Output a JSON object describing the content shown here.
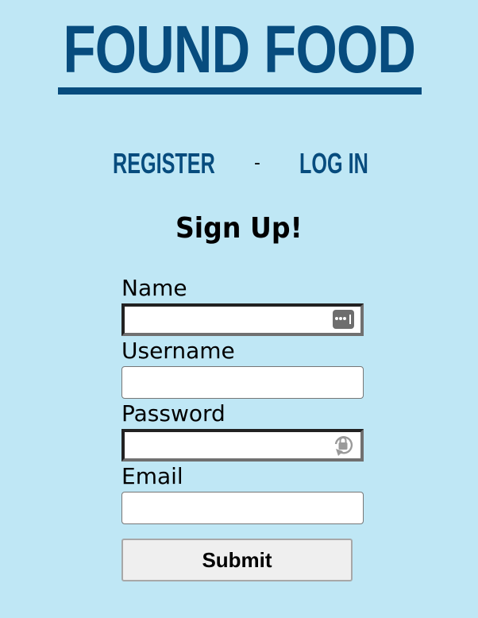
{
  "site": {
    "title": "FOUND FOOD"
  },
  "nav": {
    "register_label": "REGISTER",
    "separator": "-",
    "login_label": "LOG IN"
  },
  "form": {
    "heading": "Sign Up!",
    "fields": [
      {
        "label": "Name",
        "value": "",
        "icon": "password-manager-key-icon"
      },
      {
        "label": "Username",
        "value": ""
      },
      {
        "label": "Password",
        "value": "",
        "icon": "password-lock-icon"
      },
      {
        "label": "Email",
        "value": ""
      }
    ],
    "submit_label": "Submit"
  },
  "colors": {
    "background": "#bfe7f5",
    "brand": "#074c7e"
  }
}
